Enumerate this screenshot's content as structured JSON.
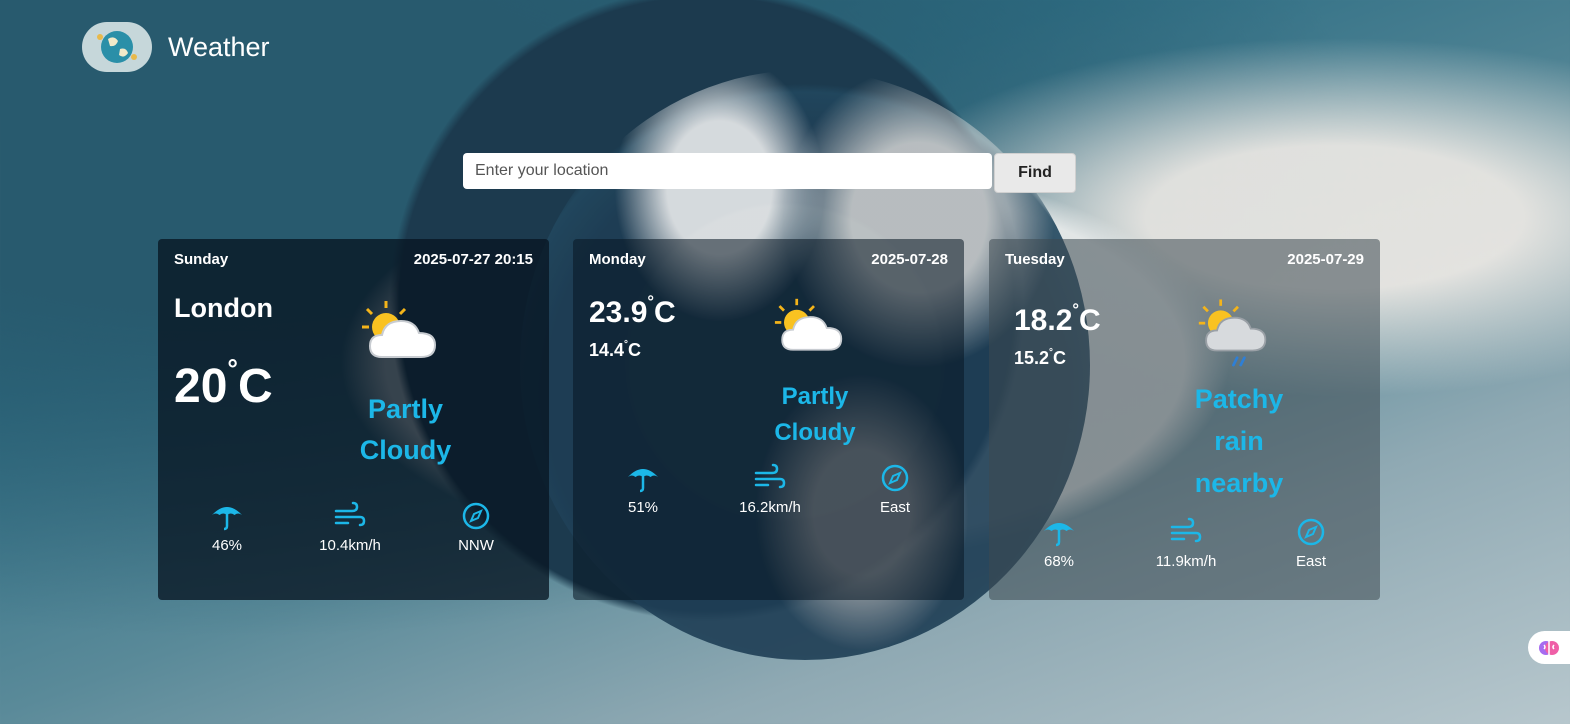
{
  "app": {
    "title": "Weather",
    "logo_icon": "globe-icon"
  },
  "search": {
    "placeholder": "Enter your location",
    "value": "",
    "button_label": "Find"
  },
  "cards": [
    {
      "day": "Sunday",
      "date": "2025-07-27 20:15",
      "city": "London",
      "temp": "20",
      "unit": "C",
      "condition_icon": "partly-cloudy-icon",
      "condition": "Partly Cloudy",
      "humidity": "46%",
      "wind_speed": "10.4km/h",
      "wind_dir": "NNW"
    },
    {
      "day": "Monday",
      "date": "2025-07-28",
      "max_temp": "23.9",
      "min_temp": "14.4",
      "unit": "C",
      "condition_icon": "partly-cloudy-icon",
      "condition": "Partly Cloudy",
      "humidity": "51%",
      "wind_speed": "16.2km/h",
      "wind_dir": "East"
    },
    {
      "day": "Tuesday",
      "date": "2025-07-29",
      "max_temp": "18.2",
      "min_temp": "15.2",
      "unit": "C",
      "condition_icon": "patchy-rain-icon",
      "condition": "Patchy rain nearby",
      "humidity": "68%",
      "wind_speed": "11.9km/h",
      "wind_dir": "East"
    }
  ],
  "colors": {
    "accent": "#1cb7e8",
    "card_text": "#ffffff"
  },
  "floating": {
    "icon": "brain-icon"
  }
}
